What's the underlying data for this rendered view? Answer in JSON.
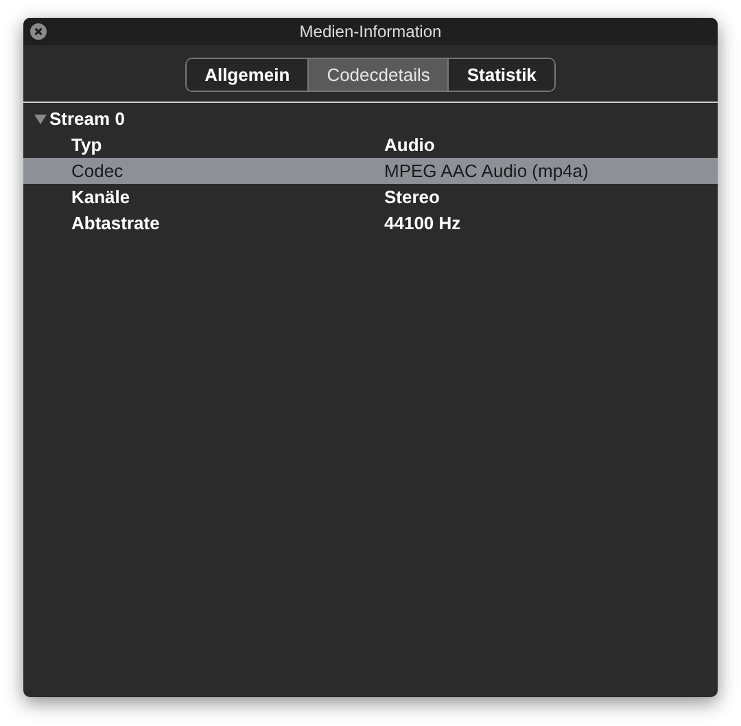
{
  "window": {
    "title": "Medien-Information"
  },
  "tabs": [
    {
      "label": "Allgemein",
      "selected": false
    },
    {
      "label": "Codecdetails",
      "selected": true
    },
    {
      "label": "Statistik",
      "selected": false
    }
  ],
  "tree": [
    {
      "label": "Stream 0",
      "expanded": true,
      "children": [
        {
          "name": "Typ",
          "value": "Audio",
          "selected": false
        },
        {
          "name": "Codec",
          "value": "MPEG AAC Audio (mp4a)",
          "selected": true
        },
        {
          "name": "Kanäle",
          "value": "Stereo",
          "selected": false
        },
        {
          "name": "Abtastrate",
          "value": "44100 Hz",
          "selected": false
        }
      ]
    }
  ]
}
